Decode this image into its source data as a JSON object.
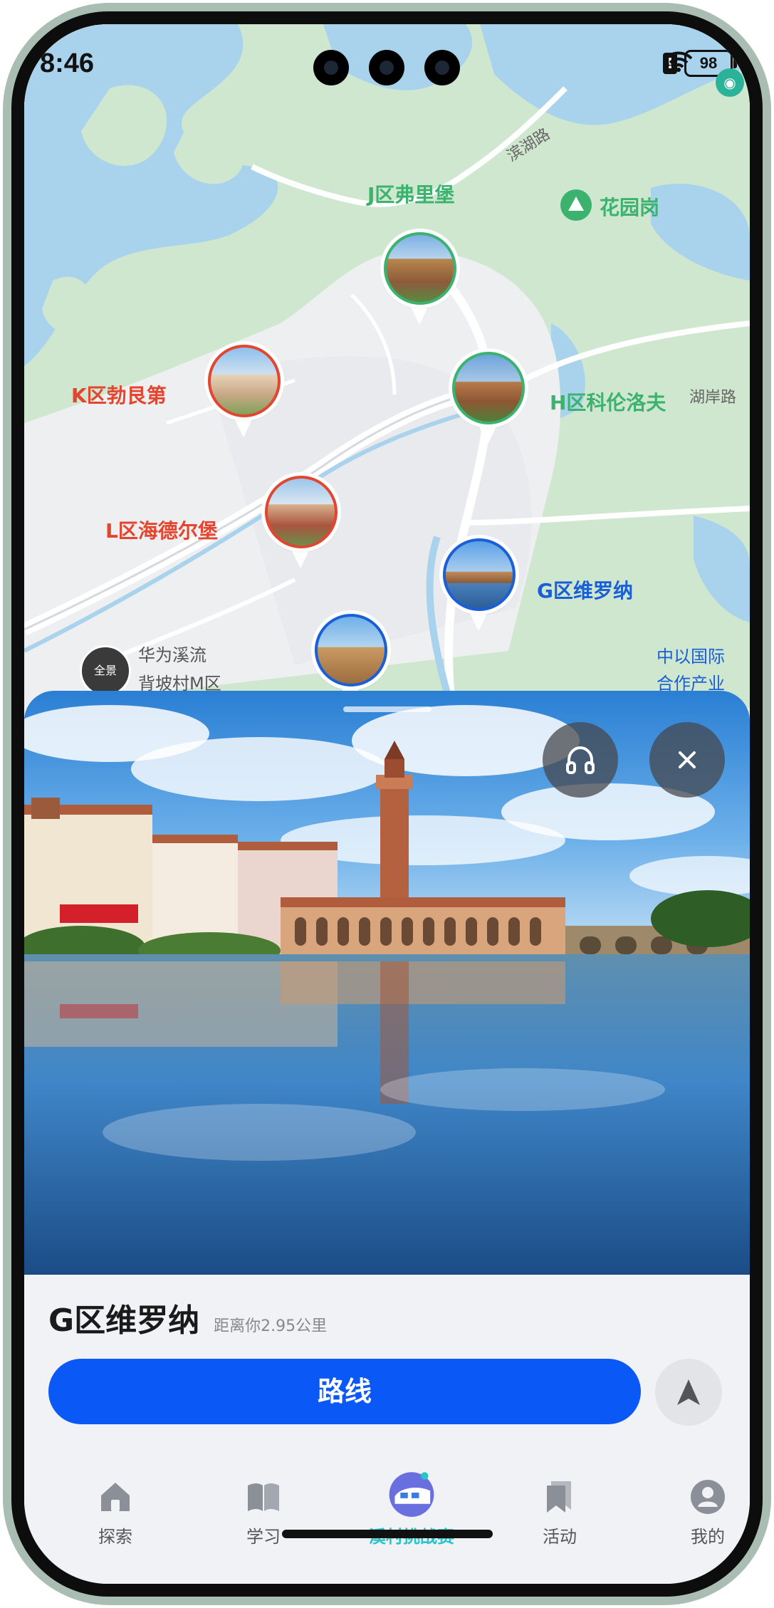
{
  "status_bar": {
    "time": "8:46",
    "battery": "98"
  },
  "map": {
    "labels": {
      "zone_j": "J区弗里堡",
      "zone_k": "K区勃艮第",
      "zone_h": "H区科伦洛夫",
      "zone_l": "L区海德尔堡",
      "zone_g": "G区维罗纳",
      "huayuangang": "花园岗",
      "binhu_road": "滨湖路",
      "hu_an_road": "湖岸路",
      "huawei_line1": "华为溪流",
      "huawei_line2": "背坡村M区",
      "zhongyi_line1": "中以国际",
      "zhongyi_line2": "合作产业",
      "poi_dark": "全景"
    }
  },
  "detail": {
    "title": "G区维罗纳",
    "distance": "距离你2.95公里",
    "route_label": "路线"
  },
  "tabs": [
    {
      "label": "探索",
      "icon": "home-icon"
    },
    {
      "label": "学习",
      "icon": "book-icon"
    },
    {
      "label": "溪村挑战赛",
      "icon": "train-icon"
    },
    {
      "label": "活动",
      "icon": "bookmark-icon"
    },
    {
      "label": "我的",
      "icon": "person-icon"
    }
  ],
  "colors": {
    "primary": "#0a59f7",
    "active_tab": "#27c4c9",
    "zone_red": "#e4452f",
    "zone_green": "#3bb36e",
    "zone_blue": "#1a5fd6"
  }
}
